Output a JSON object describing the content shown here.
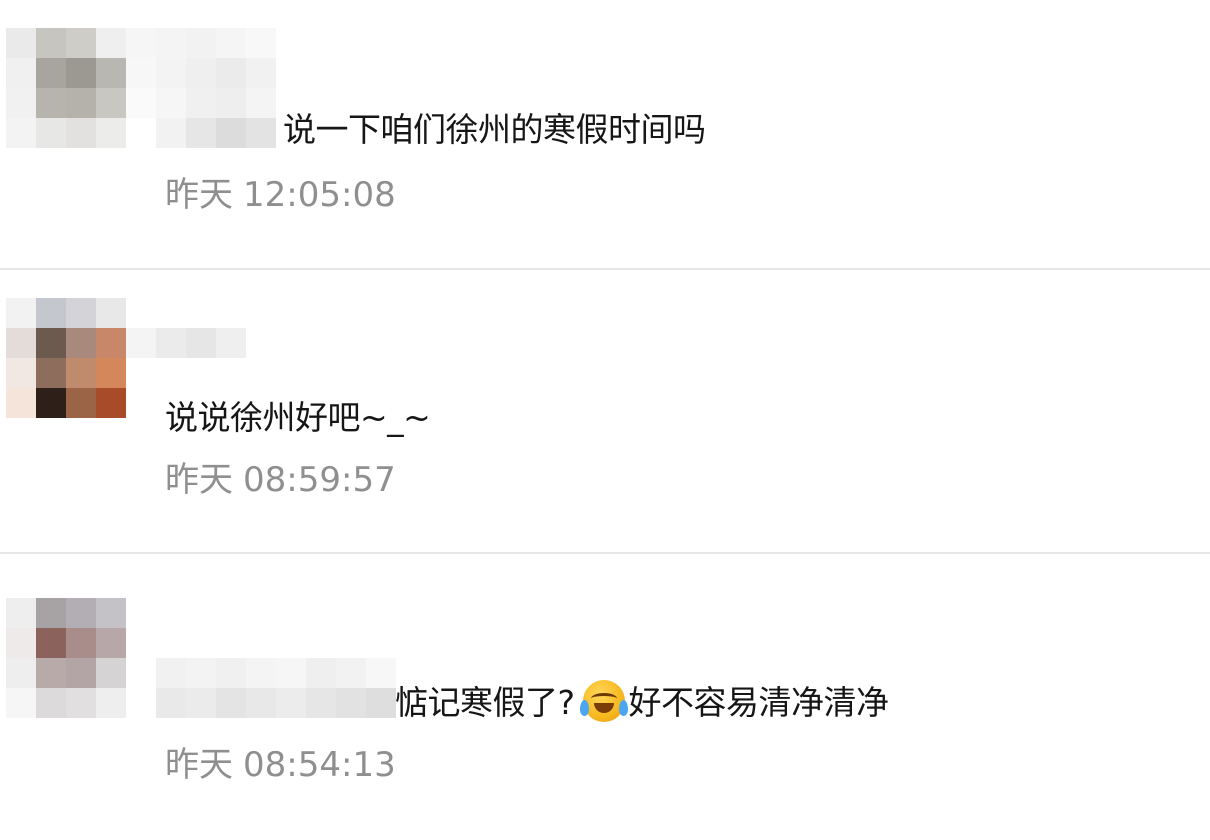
{
  "comments": [
    {
      "text": "说一下咱们徐州的寒假时间吗",
      "day": "昨天",
      "time": "12:05:08"
    },
    {
      "text": "说说徐州好吧~_~",
      "day": "昨天",
      "time": "08:59:57"
    },
    {
      "text_before": "惦记寒假了?",
      "text_after": "好不容易清净清净",
      "emoji_icon": "laugh-cry-emoji-icon",
      "day": "昨天",
      "time": "08:54:13"
    }
  ],
  "colors": {
    "text": "#161616",
    "timestamp": "#8f8f8f",
    "divider": "#e6e6e6"
  }
}
